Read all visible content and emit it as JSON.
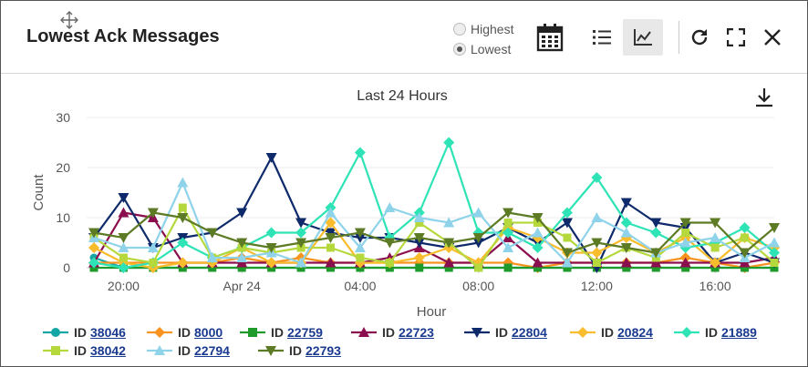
{
  "header": {
    "title": "Lowest Ack Messages",
    "radio_options": [
      {
        "label": "Highest",
        "checked": false
      },
      {
        "label": "Lowest",
        "checked": true
      }
    ]
  },
  "chart_data": {
    "type": "line",
    "title": "Last 24 Hours",
    "xlabel": "Hour",
    "ylabel": "Count",
    "ylim": [
      0,
      30
    ],
    "yticks": [
      0,
      10,
      20,
      30
    ],
    "xticks": [
      "20:00",
      "Apr 24",
      "04:00",
      "08:00",
      "12:00",
      "16:00"
    ],
    "x_hours": [
      19,
      20,
      21,
      22,
      23,
      24,
      25,
      26,
      27,
      28,
      29,
      30,
      31,
      32,
      33,
      34,
      35,
      36,
      37,
      38,
      39,
      40,
      41,
      42
    ],
    "xtick_hours": [
      20,
      24,
      28,
      32,
      36,
      40
    ],
    "grid": true,
    "series": [
      {
        "name": "ID 38046",
        "color": "#14a5a5",
        "marker": "circle",
        "values": [
          2,
          0,
          0,
          0,
          0,
          0,
          0,
          0,
          0,
          0,
          0,
          0,
          0,
          0,
          0,
          0,
          0,
          0,
          0,
          0,
          0,
          0,
          0,
          0
        ]
      },
      {
        "name": "ID 8000",
        "color": "#f7931e",
        "marker": "diamond",
        "values": [
          1,
          1,
          1,
          1,
          1,
          2,
          1,
          2,
          1,
          1,
          1,
          1,
          1,
          1,
          1,
          0,
          1,
          1,
          1,
          1,
          2,
          1,
          0,
          1
        ]
      },
      {
        "name": "ID 22759",
        "color": "#1e9b2a",
        "marker": "square",
        "values": [
          0,
          0,
          0,
          0,
          0,
          0,
          0,
          0,
          0,
          0,
          0,
          0,
          0,
          0,
          0,
          0,
          0,
          0,
          0,
          0,
          0,
          0,
          0,
          0
        ]
      },
      {
        "name": "ID 22723",
        "color": "#8b0f4e",
        "marker": "triangle",
        "values": [
          1,
          11,
          10,
          1,
          1,
          1,
          1,
          1,
          1,
          1,
          2,
          4,
          1,
          1,
          6,
          1,
          1,
          1,
          1,
          1,
          1,
          1,
          1,
          2
        ]
      },
      {
        "name": "ID 22804",
        "color": "#0f2a6b",
        "marker": "tri-down",
        "values": [
          6,
          14,
          4,
          6,
          7,
          11,
          22,
          9,
          7,
          6,
          6,
          5,
          4,
          5,
          8,
          5,
          9,
          0,
          13,
          9,
          8,
          1,
          3,
          1
        ]
      },
      {
        "name": "ID 20824",
        "color": "#f9bc2c",
        "marker": "diamond",
        "values": [
          4,
          1,
          0,
          1,
          1,
          4,
          1,
          1,
          9,
          1,
          1,
          2,
          4,
          1,
          8,
          6,
          3,
          3,
          6,
          3,
          6,
          1,
          6,
          4
        ]
      },
      {
        "name": "ID 21889",
        "color": "#2ee3b5",
        "marker": "diamond",
        "values": [
          1,
          0,
          1,
          5,
          2,
          4,
          7,
          7,
          12,
          23,
          6,
          11,
          25,
          7,
          7,
          4,
          11,
          18,
          9,
          7,
          4,
          5,
          8,
          3
        ]
      },
      {
        "name": "ID 38042",
        "color": "#b5d93c",
        "marker": "square",
        "values": [
          6,
          2,
          1,
          12,
          2,
          4,
          3,
          4,
          4,
          2,
          1,
          9,
          5,
          0,
          9,
          9,
          6,
          1,
          4,
          2,
          7,
          4,
          6,
          1
        ]
      },
      {
        "name": "ID 22794",
        "color": "#8fd3ea",
        "marker": "triangle",
        "values": [
          6,
          4,
          4,
          17,
          2,
          2,
          3,
          1,
          11,
          4,
          12,
          10,
          9,
          11,
          4,
          7,
          1,
          10,
          7,
          3,
          5,
          6,
          2,
          5
        ]
      },
      {
        "name": "ID 22793",
        "color": "#5d7a24",
        "marker": "tri-down",
        "values": [
          7,
          6,
          11,
          10,
          7,
          5,
          4,
          5,
          6,
          7,
          5,
          6,
          5,
          6,
          11,
          10,
          3,
          5,
          4,
          3,
          9,
          9,
          3,
          8
        ]
      }
    ]
  },
  "legend": [
    {
      "prefix": "ID",
      "link": "38046"
    },
    {
      "prefix": "ID",
      "link": "8000"
    },
    {
      "prefix": "ID",
      "link": "22759"
    },
    {
      "prefix": "ID",
      "link": "22723"
    },
    {
      "prefix": "ID",
      "link": "22804"
    },
    {
      "prefix": "ID",
      "link": "20824"
    },
    {
      "prefix": "ID",
      "link": "21889"
    },
    {
      "prefix": "ID",
      "link": "38042"
    },
    {
      "prefix": "ID",
      "link": "22794"
    },
    {
      "prefix": "ID",
      "link": "22793"
    }
  ]
}
